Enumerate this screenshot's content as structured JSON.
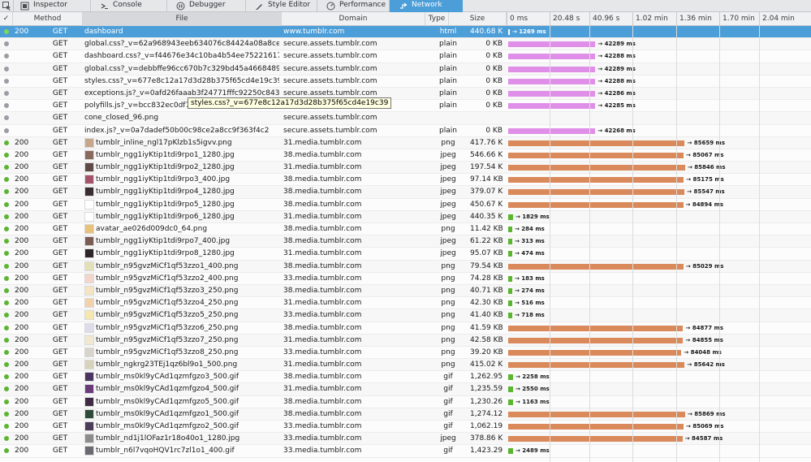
{
  "toolbar": {
    "tabs": [
      {
        "name": "inspector",
        "label": "Inspector",
        "icon": "inspector-icon"
      },
      {
        "name": "console",
        "label": "Console",
        "icon": "console-icon"
      },
      {
        "name": "debugger",
        "label": "Debugger",
        "icon": "debugger-icon"
      },
      {
        "name": "style-editor",
        "label": "Style Editor",
        "icon": "style-editor-icon"
      },
      {
        "name": "performance",
        "label": "Performance",
        "icon": "performance-icon"
      },
      {
        "name": "network",
        "label": "Network",
        "icon": "network-icon",
        "active": true
      }
    ]
  },
  "columns": {
    "check": "✓",
    "method": "Method",
    "file": "File",
    "domain": "Domain",
    "type": "Type",
    "size": "Size"
  },
  "timeline": {
    "ticks": [
      "0 ms",
      "20.48 s",
      "40.96 s",
      "1.02 min",
      "1.36 min",
      "1.70 min",
      "2.04 min"
    ]
  },
  "colors": {
    "accent": "#4c9ed9",
    "status_ok": "#5bb531",
    "status_pending": "#9a9ea4",
    "bar_plain": "#e08fe8",
    "bar_image": "#d9895a",
    "bar_short": "#5bb531"
  },
  "tooltip": "styles.css?_v=677e8c12a17d3d28b375f65cd4e19c39",
  "requests": [
    {
      "status": "200",
      "method": "GET",
      "file": "dashboard",
      "domain": "www.tumblr.com",
      "type": "html",
      "size": "440.68 KB",
      "time": "→ 1269 ms",
      "ms": 1269,
      "selected": true
    },
    {
      "status": "",
      "method": "GET",
      "file": "global.css?_v=62a968943eeb634076c84424a08a8ced",
      "domain": "secure.assets.tumblr.com",
      "type": "plain",
      "size": "0 KB",
      "time": "→ 42289 ms",
      "ms": 42289
    },
    {
      "status": "",
      "method": "GET",
      "file": "dashboard.css?_v=f44676e34c10ba4b54ee75221617ecb5",
      "domain": "secure.assets.tumblr.com",
      "type": "plain",
      "size": "0 KB",
      "time": "→ 42288 ms",
      "ms": 42288
    },
    {
      "status": "",
      "method": "GET",
      "file": "global.css?_v=debbffe96cc670b7c329bd45a4668489",
      "domain": "secure.assets.tumblr.com",
      "type": "plain",
      "size": "0 KB",
      "time": "→ 42289 ms",
      "ms": 42289
    },
    {
      "status": "",
      "method": "GET",
      "file": "styles.css?_v=677e8c12a17d3d28b375f65cd4e19c39",
      "domain": "secure.assets.tumblr.com",
      "type": "plain",
      "size": "0 KB",
      "time": "→ 42288 ms",
      "ms": 42288
    },
    {
      "status": "",
      "method": "GET",
      "file": "exceptions.js?_v=0afd26faaab3f24771fffc92250c8438",
      "domain": "secure.assets.tumblr.com",
      "type": "plain",
      "size": "0 KB",
      "time": "→ 42286 ms",
      "ms": 42286
    },
    {
      "status": "",
      "method": "GET",
      "file": "polyfills.js?_v=bcc832ec0df74eda",
      "domain": "secure.assets.tumblr.com",
      "type": "plain",
      "size": "0 KB",
      "time": "→ 42285 ms",
      "ms": 42285
    },
    {
      "status": "",
      "method": "GET",
      "file": "cone_closed_96.png",
      "domain": "secure.assets.tumblr.com",
      "type": "",
      "size": "",
      "time": "",
      "ms": 0
    },
    {
      "status": "",
      "method": "GET",
      "file": "index.js?_v=0a7dadef50b00c98ce2a8cc9f363f4c2",
      "domain": "secure.assets.tumblr.com",
      "type": "plain",
      "size": "0 KB",
      "time": "→ 42268 ms",
      "ms": 42268
    },
    {
      "status": "200",
      "method": "GET",
      "file": "tumblr_inline_ngl17pKlzb1s5igvv.png",
      "domain": "31.media.tumblr.com",
      "type": "png",
      "size": "417.76 KB",
      "time": "→ 85659 ms",
      "ms": 85659,
      "thumb": "#c7a78c"
    },
    {
      "status": "200",
      "method": "GET",
      "file": "tumblr_ngg1iyKtip1tdi9rpo1_1280.jpg",
      "domain": "38.media.tumblr.com",
      "type": "jpeg",
      "size": "546.66 KB",
      "time": "→ 85067 ms",
      "ms": 85067,
      "thumb": "#8a6a5c"
    },
    {
      "status": "200",
      "method": "GET",
      "file": "tumblr_ngg1iyKtip1tdi9rpo2_1280.jpg",
      "domain": "31.media.tumblr.com",
      "type": "jpeg",
      "size": "197.54 KB",
      "time": "→ 85846 ms",
      "ms": 85846,
      "thumb": "#5d4a46"
    },
    {
      "status": "200",
      "method": "GET",
      "file": "tumblr_ngg1iyKtip1tdi9rpo3_400.jpg",
      "domain": "38.media.tumblr.com",
      "type": "jpeg",
      "size": "97.14 KB",
      "time": "→ 85175 ms",
      "ms": 85175,
      "thumb": "#a5536a"
    },
    {
      "status": "200",
      "method": "GET",
      "file": "tumblr_ngg1iyKtip1tdi9rpo4_1280.jpg",
      "domain": "38.media.tumblr.com",
      "type": "jpeg",
      "size": "379.07 KB",
      "time": "→ 85547 ms",
      "ms": 85547,
      "thumb": "#3a2e35"
    },
    {
      "status": "200",
      "method": "GET",
      "file": "tumblr_ngg1iyKtip1tdi9rpo5_1280.jpg",
      "domain": "38.media.tumblr.com",
      "type": "jpeg",
      "size": "450.67 KB",
      "time": "→ 84894 ms",
      "ms": 84894,
      "thumb": "#ffffff"
    },
    {
      "status": "200",
      "method": "GET",
      "file": "tumblr_ngg1iyKtip1tdi9rpo6_1280.jpg",
      "domain": "31.media.tumblr.com",
      "type": "jpeg",
      "size": "440.35 KB",
      "time": "→ 1829 ms",
      "ms": 1829,
      "thumb": "#ffffff"
    },
    {
      "status": "200",
      "method": "GET",
      "file": "avatar_ae026d009dc0_64.png",
      "domain": "38.media.tumblr.com",
      "type": "png",
      "size": "11.42 KB",
      "time": "→ 284 ms",
      "ms": 284,
      "thumb": "#e8c27a"
    },
    {
      "status": "200",
      "method": "GET",
      "file": "tumblr_ngg1iyKtip1tdi9rpo7_400.jpg",
      "domain": "38.media.tumblr.com",
      "type": "jpeg",
      "size": "61.22 KB",
      "time": "→ 313 ms",
      "ms": 313,
      "thumb": "#7b5b55"
    },
    {
      "status": "200",
      "method": "GET",
      "file": "tumblr_ngg1iyKtip1tdi9rpo8_1280.jpg",
      "domain": "31.media.tumblr.com",
      "type": "jpeg",
      "size": "95.07 KB",
      "time": "→ 474 ms",
      "ms": 474,
      "thumb": "#2e2528"
    },
    {
      "status": "200",
      "method": "GET",
      "file": "tumblr_n95gvzMiCf1qf53zzo1_400.png",
      "domain": "38.media.tumblr.com",
      "type": "png",
      "size": "79.54 KB",
      "time": "→ 85029 ms",
      "ms": 85029,
      "thumb": "#e3e0b8"
    },
    {
      "status": "200",
      "method": "GET",
      "file": "tumblr_n95gvzMiCf1qf53zzo2_400.png",
      "domain": "33.media.tumblr.com",
      "type": "png",
      "size": "74.28 KB",
      "time": "→ 183 ms",
      "ms": 183,
      "thumb": "#f2d6cc"
    },
    {
      "status": "200",
      "method": "GET",
      "file": "tumblr_n95gvzMiCf1qf53zzo3_250.png",
      "domain": "38.media.tumblr.com",
      "type": "png",
      "size": "40.71 KB",
      "time": "→ 274 ms",
      "ms": 274,
      "thumb": "#f4e4c2"
    },
    {
      "status": "200",
      "method": "GET",
      "file": "tumblr_n95gvzMiCf1qf53zzo4_250.png",
      "domain": "31.media.tumblr.com",
      "type": "png",
      "size": "42.30 KB",
      "time": "→ 516 ms",
      "ms": 516,
      "thumb": "#f1d2ac"
    },
    {
      "status": "200",
      "method": "GET",
      "file": "tumblr_n95gvzMiCf1qf53zzo5_250.png",
      "domain": "33.media.tumblr.com",
      "type": "png",
      "size": "41.40 KB",
      "time": "→ 718 ms",
      "ms": 718,
      "thumb": "#f6e6b0"
    },
    {
      "status": "200",
      "method": "GET",
      "file": "tumblr_n95gvzMiCf1qf53zzo6_250.png",
      "domain": "38.media.tumblr.com",
      "type": "png",
      "size": "41.59 KB",
      "time": "→ 84877 ms",
      "ms": 84877,
      "thumb": "#dcdde8"
    },
    {
      "status": "200",
      "method": "GET",
      "file": "tumblr_n95gvzMiCf1qf53zzo7_250.png",
      "domain": "31.media.tumblr.com",
      "type": "png",
      "size": "42.58 KB",
      "time": "→ 84855 ms",
      "ms": 84855,
      "thumb": "#f0e8d0"
    },
    {
      "status": "200",
      "method": "GET",
      "file": "tumblr_n95gvzMiCf1qf53zzo8_250.png",
      "domain": "33.media.tumblr.com",
      "type": "png",
      "size": "39.20 KB",
      "time": "→ 84048 ms",
      "ms": 84048,
      "thumb": "#d8d4cc"
    },
    {
      "status": "200",
      "method": "GET",
      "file": "tumblr_ngkrg23TEj1qz6bl9o1_500.png",
      "domain": "31.media.tumblr.com",
      "type": "png",
      "size": "415.02 KB",
      "time": "→ 85642 ms",
      "ms": 85642,
      "thumb": "#d6d2bc"
    },
    {
      "status": "200",
      "method": "GET",
      "file": "tumblr_ms0kl9yCAd1qzmfgzo3_500.gif",
      "domain": "38.media.tumblr.com",
      "type": "gif",
      "size": "1,262.95 KB",
      "time": "→ 2258 ms",
      "ms": 2258,
      "thumb": "#4a3560"
    },
    {
      "status": "200",
      "method": "GET",
      "file": "tumblr_ms0kl9yCAd1qzmfgzo4_500.gif",
      "domain": "31.media.tumblr.com",
      "type": "gif",
      "size": "1,235.59 KB",
      "time": "→ 2550 ms",
      "ms": 2550,
      "thumb": "#6a3a7a"
    },
    {
      "status": "200",
      "method": "GET",
      "file": "tumblr_ms0kl9yCAd1qzmfgzo5_500.gif",
      "domain": "38.media.tumblr.com",
      "type": "gif",
      "size": "1,230.26 KB",
      "time": "→ 1163 ms",
      "ms": 1163,
      "thumb": "#3f2c44"
    },
    {
      "status": "200",
      "method": "GET",
      "file": "tumblr_ms0kl9yCAd1qzmfgzo1_500.gif",
      "domain": "38.media.tumblr.com",
      "type": "gif",
      "size": "1,274.12 KB",
      "time": "→ 85869 ms",
      "ms": 85869,
      "thumb": "#2d4a3a"
    },
    {
      "status": "200",
      "method": "GET",
      "file": "tumblr_ms0kl9yCAd1qzmfgzo2_500.gif",
      "domain": "33.media.tumblr.com",
      "type": "gif",
      "size": "1,062.19 KB",
      "time": "→ 85069 ms",
      "ms": 85069,
      "thumb": "#4d3d5a"
    },
    {
      "status": "200",
      "method": "GET",
      "file": "tumblr_nd1j1lOFaz1r18o40o1_1280.jpg",
      "domain": "33.media.tumblr.com",
      "type": "jpeg",
      "size": "378.86 KB",
      "time": "→ 84587 ms",
      "ms": 84587,
      "thumb": "#8c8c8c"
    },
    {
      "status": "200",
      "method": "GET",
      "file": "tumblr_n6l7vqoHQV1rc7zl1o1_400.gif",
      "domain": "33.media.tumblr.com",
      "type": "gif",
      "size": "1,423.29 KB",
      "time": "→ 2489 ms",
      "ms": 2489,
      "thumb": "#6a6a70"
    }
  ]
}
